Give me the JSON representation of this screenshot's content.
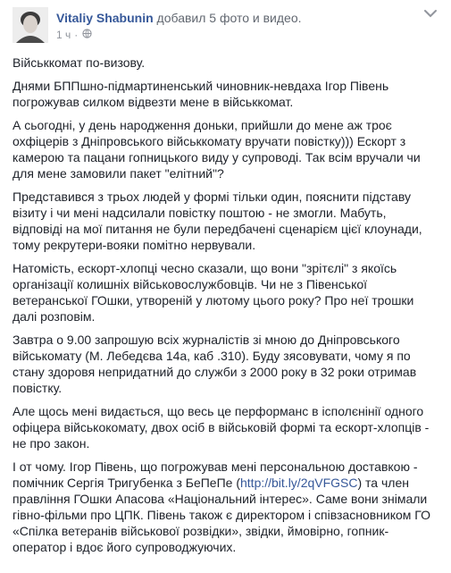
{
  "post": {
    "author": "Vitaliy Shabunin",
    "action": "добавил 5 фото и видео.",
    "time": "1 ч",
    "separator": "·"
  },
  "paragraphs": [
    {
      "text": "Військкомат по-визову."
    },
    {
      "text": "Днями БППшно-підмартиненський чиновник-невдаха Ігор Півень погрожував силком відвезти мене в військкомат."
    },
    {
      "text": "А сьогодні, у день народження доньки, прийшли до мене аж троє охфіцерів з Дніпровського військкомату вручати повістку))) Ескорт з камерою та пацани гопницького виду у супроводі. Так всім вручали чи для мене замовили пакет \"елітний\"?"
    },
    {
      "text": "Представився з трьох людей у формі тільки один, пояснити підставу візиту і чи мені надсилали повістку поштою - не змогли. Мабуть, відповіді на мої питання не були передбачені сценарієм цієї клоунади, тому рекрутери-вояки помітно нервували."
    },
    {
      "text": "Натомість, ескорт-хлопці чесно сказали, що вони \"зрітєлі\" з якоїсь організації колишніх військовослужбовців. Чи не з Півенської ветеранської ГОшки, утвореній у лютому цього року? Про неї трошки далі розповім."
    },
    {
      "text": "Завтра о 9.00 запрошую всіх журналістів зі мною до Дніпровського військомату (М. Лебедєва 14а, каб .310). Буду зясовувати, чому я по стану здоровя непридатний до служби з 2000 року в 32 роки отримав повістку."
    },
    {
      "text": "Але щось мені видається, що весь це перформанс в ісполєнінії одного офіцера військокомату, двох осіб в військовій формі та ескорт-хлопців - не про закон."
    },
    {
      "before": "І от чому. Ігор Півень, що погрожував мені персональною доставкою - помічник Сергія Тригубенка з БеПеПе (",
      "link": "http://bit.ly/2qVFGSC",
      "after": ") та член правління ГОшки Апасова «Національний інтерес». Саме вони знімали гівно-фільми про ЦПК. Півень також є директором і співзасновником ГО «Спілка ветеранів військової розвідки», звідки, ймовірно, гопник-оператор і вдоє його супроводжуючих."
    }
  ]
}
